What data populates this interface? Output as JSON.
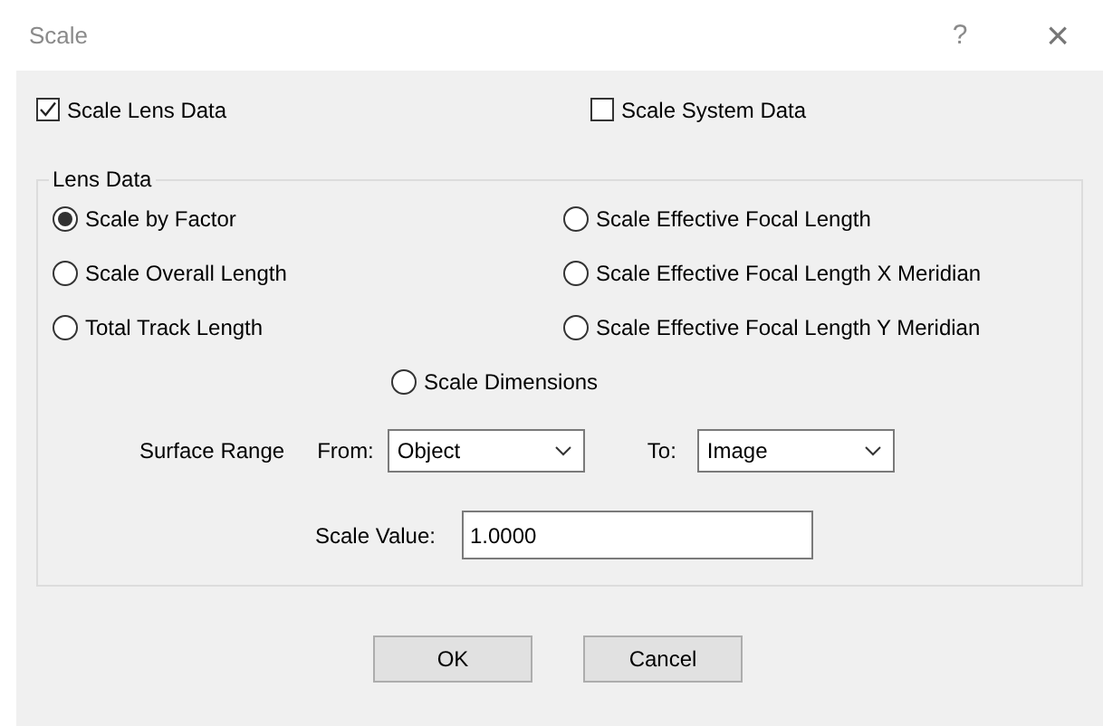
{
  "window": {
    "title": "Scale",
    "help": "?",
    "close": "×"
  },
  "checkboxes": [
    {
      "label": "Scale Lens Data",
      "checked": true
    },
    {
      "label": "Scale System Data",
      "checked": false
    }
  ],
  "lens_data": {
    "title": "Lens Data",
    "options": [
      {
        "label": "Scale by Factor",
        "selected": true
      },
      {
        "label": "Scale Effective Focal Length",
        "selected": false
      },
      {
        "label": "Scale Overall Length",
        "selected": false
      },
      {
        "label": "Scale Effective Focal Length X Meridian",
        "selected": false
      },
      {
        "label": "Total Track Length",
        "selected": false
      },
      {
        "label": "Scale Effective Focal Length Y Meridian",
        "selected": false
      },
      {
        "label": "Scale Dimensions",
        "selected": false
      }
    ],
    "surface_range": {
      "label": "Surface Range",
      "from_label": "From:",
      "from_value": "Object",
      "to_label": "To:",
      "to_value": "Image"
    },
    "scale_value": {
      "label": "Scale Value:",
      "value": "1.0000"
    }
  },
  "buttons": [
    "OK",
    "Cancel"
  ]
}
